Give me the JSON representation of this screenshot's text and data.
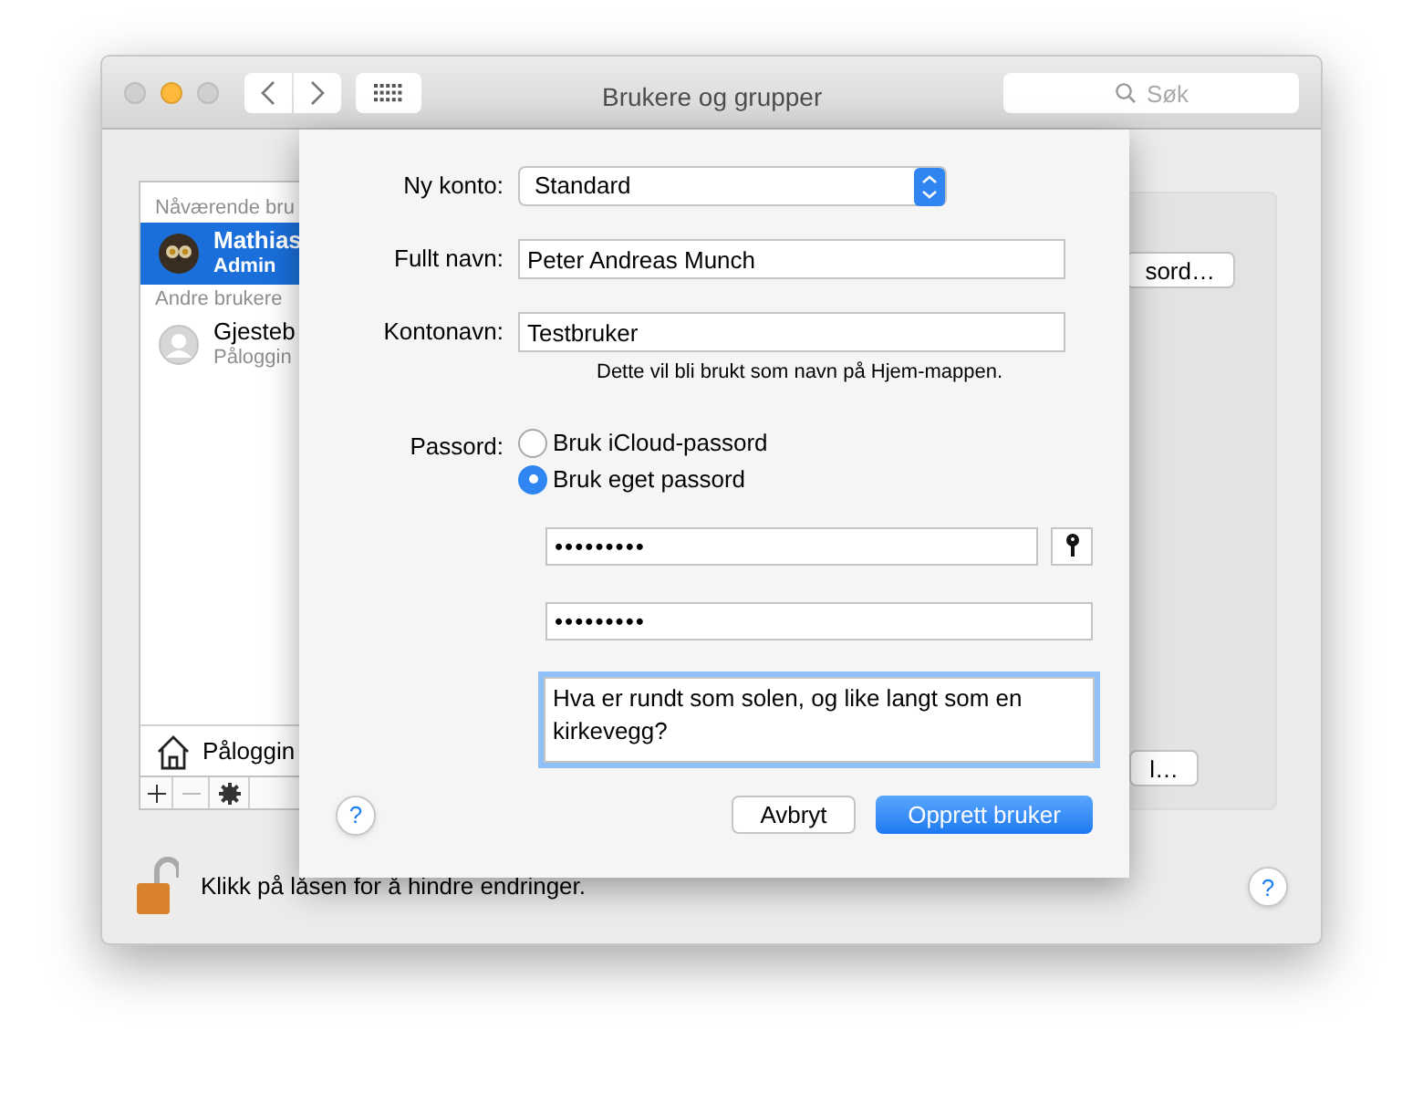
{
  "window": {
    "title": "Brukere og grupper",
    "search": {
      "placeholder": "Søk"
    }
  },
  "sidebar": {
    "sections": [
      {
        "heading": "Nåværende bru",
        "items": [
          {
            "name": "Mathias",
            "role": "Admin",
            "kind": "owl",
            "selected": true
          }
        ]
      },
      {
        "heading": "Andre brukere",
        "items": [
          {
            "name": "Gjesteb",
            "role": "Påloggin",
            "kind": "person",
            "selected": false
          }
        ]
      }
    ],
    "login_options": "Påloggin"
  },
  "panel": {
    "buttons": [
      "sord…",
      "l…"
    ]
  },
  "sheet": {
    "account_type": {
      "label": "Ny konto:",
      "value": "Standard"
    },
    "full_name": {
      "label": "Fullt navn:",
      "value": "Peter Andreas Munch"
    },
    "account_name": {
      "label": "Kontonavn:",
      "value": "Testbruker",
      "note": "Dette vil bli brukt som navn på Hjem-mappen."
    },
    "password": {
      "label": "Passord:",
      "options": [
        {
          "label": "Bruk iCloud-passord",
          "selected": false
        },
        {
          "label": "Bruk eget passord",
          "selected": true
        }
      ],
      "password": "•••••••••",
      "verify": "•••••••••",
      "hint": {
        "value": "Hva er rundt som solen, og like langt som en kirkevegg?"
      }
    },
    "help": "?",
    "buttons": [
      {
        "label": "Avbryt",
        "kind": "default"
      },
      {
        "label": "Opprett bruker",
        "kind": "primary"
      }
    ]
  },
  "footer": {
    "lock_text": "Klikk på låsen for å hindre endringer.",
    "help": "?"
  }
}
